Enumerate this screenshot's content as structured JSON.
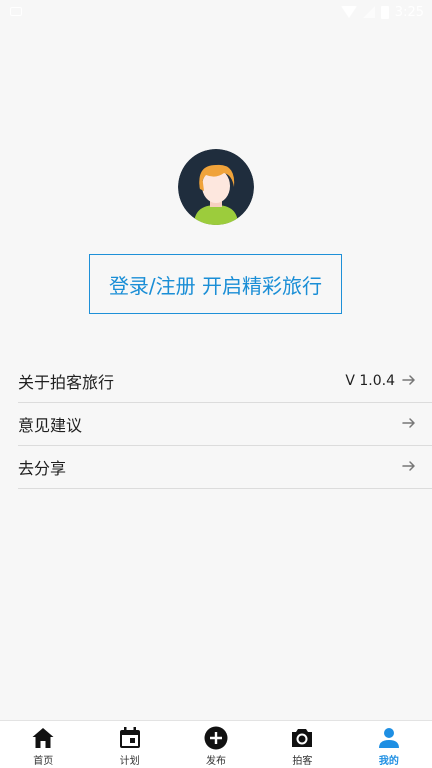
{
  "status_bar": {
    "time": "3:25"
  },
  "profile": {
    "login_label": "登录/注册 开启精彩旅行"
  },
  "menu": {
    "items": [
      {
        "label": "关于拍客旅行",
        "value": "V 1.0.4"
      },
      {
        "label": "意见建议",
        "value": ""
      },
      {
        "label": "去分享",
        "value": ""
      }
    ]
  },
  "bottom_nav": {
    "items": [
      {
        "label": "首页",
        "icon": "home-icon"
      },
      {
        "label": "计划",
        "icon": "calendar-icon"
      },
      {
        "label": "发布",
        "icon": "add-circle-icon"
      },
      {
        "label": "拍客",
        "icon": "camera-icon"
      },
      {
        "label": "我的",
        "icon": "person-icon"
      }
    ],
    "active_index": 4
  },
  "colors": {
    "accent": "#1a8ed6",
    "active_tab": "#1e8fe3",
    "background": "#f7f7f7",
    "avatar_bg": "#1f2d3d",
    "avatar_hair": "#f0a33a",
    "avatar_shirt": "#9ccc3c"
  }
}
